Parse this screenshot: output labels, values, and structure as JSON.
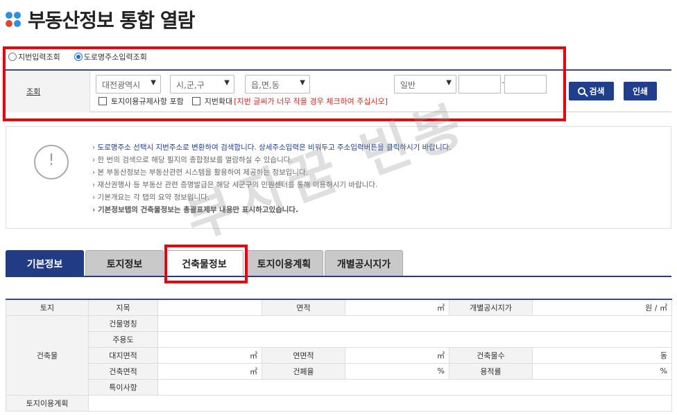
{
  "page": {
    "title": "부동산정보 통합 열람"
  },
  "search": {
    "mode_options": [
      "지번입력조회",
      "도로명주소입력조회"
    ],
    "selected_mode": "도로명주소입력조회",
    "label": "조회",
    "sido": "대전광역시",
    "sigungu": "시,군,구",
    "eupmyeondong": "읍,면,동",
    "land_type": "일반",
    "chk_land_use": "토지이용규제사항 포함",
    "chk_zoom": "지번확대",
    "zoom_warning": "[지번 글씨가 너무 작을 경우 체크하여 주십시오]",
    "search_button": "검색",
    "print_button": "인쇄"
  },
  "notice": {
    "items": [
      "도로명주소 선택시 지번주소로 변환하여 검색합니다. 상세주소입력은 비워두고 주소입력버튼을 클릭하시기 바랍니다.",
      "한 번의 검색으로 해당 필지의 종합정보를 열람하실 수 있습니다.",
      "본 부동산정보는 부동산관련 시스템을 활용하여 제공하는 정보입니다.",
      "재산권행사 등 부동산 관련 증명발급은 해당 시군구의 민원센터를 통해 이용하시기 바랍니다.",
      "기본개요는 각 탭의 요약 정보입니다.",
      "기본정보탭의 건축물정보는 총괄표제부 내용만 표시하고있습니다."
    ]
  },
  "watermark": "부자꿈 빈봉",
  "tabs": [
    "기본정보",
    "토지정보",
    "건축물정보",
    "토지이용계획",
    "개별공시지가"
  ],
  "active_tab": "기본정보",
  "table": {
    "land": "토지",
    "jimok": "지목",
    "area": "면적",
    "sqm": "㎡",
    "official_price": "개별공시지가",
    "won_per_sqm": "원 / ㎡",
    "building": "건축물",
    "building_name": "건물명칭",
    "main_use": "주용도",
    "site_area": "대지면적",
    "total_floor_area": "연면적",
    "floors": "건축물수",
    "dong": "동",
    "building_area": "건축면적",
    "coverage": "건폐율",
    "percent": "%",
    "far": "용적률",
    "special": "특이사항",
    "land_use_plan": "토지이용계획"
  }
}
